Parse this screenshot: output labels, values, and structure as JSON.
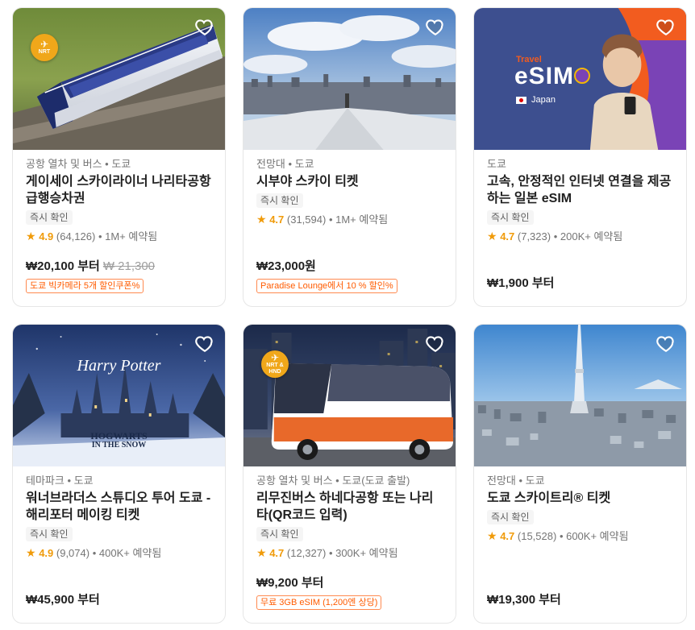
{
  "cards": [
    {
      "category": "공항 열차 및 버스 • 도쿄",
      "title": "게이세이 스카이라이너 나리타공항 급행승차권",
      "tag": "즉시 확인",
      "rating": "4.9",
      "reviews": "(64,126)",
      "booked": "• 1M+ 예약됨",
      "price": "₩20,100 부터",
      "old_price": "₩ 21,300",
      "promo": "도쿄 빅카메라 5개 할인쿠폰%",
      "badge": "NRT",
      "image_icon": "train-photo"
    },
    {
      "category": "전망대 • 도쿄",
      "title": "시부야 스카이 티켓",
      "tag": "즉시 확인",
      "rating": "4.7",
      "reviews": "(31,594)",
      "booked": "• 1M+ 예약됨",
      "price": "₩23,000원",
      "promo": "Paradise Lounge에서 10 % 할인%",
      "image_icon": "skyline-photo"
    },
    {
      "category": "도쿄",
      "title": "고속, 안정적인 인터넷 연결을 제공하는 일본 eSIM",
      "tag": "즉시 확인",
      "rating": "4.7",
      "reviews": "(7,323)",
      "booked": "• 200K+ 예약됨",
      "price": "₩1,900 부터",
      "image_travel": "Travel",
      "image_esim": "eSIM",
      "image_japan": "Japan",
      "image_icon": "esim-ad"
    },
    {
      "category": "테마파크 • 도쿄",
      "title": "워너브라더스 스튜디오 투어 도쿄 - 해리포터 메이킹 티켓",
      "tag": "즉시 확인",
      "rating": "4.9",
      "reviews": "(9,074)",
      "booked": "• 400K+ 예약됨",
      "price": "₩45,900 부터",
      "image_harry": "Harry Potter",
      "image_hogwarts": "HOGWARTS",
      "image_snow": "IN THE SNOW",
      "image_icon": "castle-photo"
    },
    {
      "category": "공항 열차 및 버스 • 도쿄(도쿄 출발)",
      "title": "리무진버스 하네다공항 또는 나리타(QR코드 입력)",
      "tag": "즉시 확인",
      "rating": "4.7",
      "reviews": "(12,327)",
      "booked": "• 300K+ 예약됨",
      "price": "₩9,200 부터",
      "promo": "무료 3GB eSIM (1,200엔 상당)",
      "badge": "NRT & HND",
      "image_bus": "Airport Limousine",
      "image_icon": "bus-photo"
    },
    {
      "category": "전망대 • 도쿄",
      "title": "도쿄 스카이트리® 티켓",
      "tag": "즉시 확인",
      "rating": "4.7",
      "reviews": "(15,528)",
      "booked": "• 600K+ 예약됨",
      "price": "₩19,300 부터",
      "image_icon": "tower-photo"
    }
  ],
  "colors": {
    "accent": "#f09b0a",
    "promo": "#ff5b00",
    "badge": "#f0a71a"
  }
}
